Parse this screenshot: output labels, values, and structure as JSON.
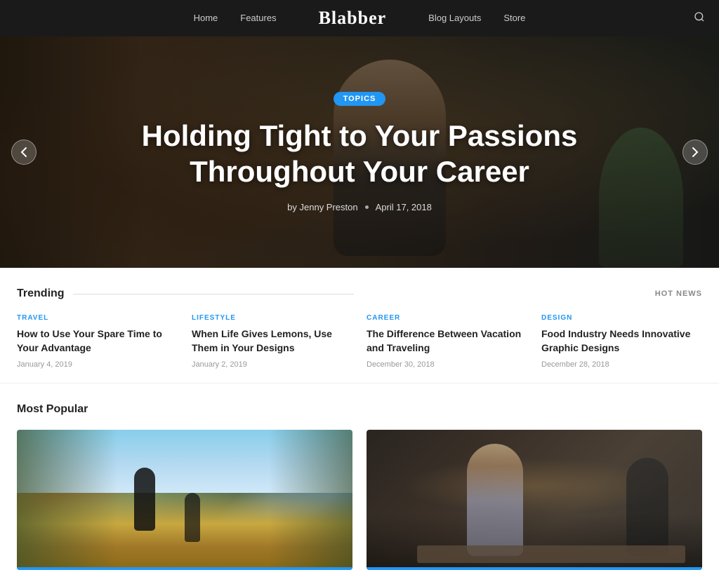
{
  "nav": {
    "links": [
      "Home",
      "Features",
      "Blog Layouts",
      "Store"
    ],
    "logo": "Blabber"
  },
  "hero": {
    "badge": "TOPICS",
    "title": "Holding Tight to Your Passions Throughout Your Career",
    "author": "by Jenny Preston",
    "date": "April 17, 2018"
  },
  "trending": {
    "section_title": "Trending",
    "hot_news_label": "HOT NEWS",
    "cards": [
      {
        "category": "TRAVEL",
        "category_class": "cat-travel",
        "title": "How to Use Your Spare Time to Your Advantage",
        "date": "January 4, 2019"
      },
      {
        "category": "LIFESTYLE",
        "category_class": "cat-lifestyle",
        "title": "When Life Gives Lemons, Use Them in Your Designs",
        "date": "January 2, 2019"
      },
      {
        "category": "CAREER",
        "category_class": "cat-career",
        "title": "The Difference Between Vacation and Traveling",
        "date": "December 30, 2018"
      },
      {
        "category": "DESIGN",
        "category_class": "cat-design",
        "title": "Food Industry Needs Innovative Graphic Designs",
        "date": "December 28, 2018"
      }
    ]
  },
  "popular": {
    "section_title": "Most Popular"
  }
}
